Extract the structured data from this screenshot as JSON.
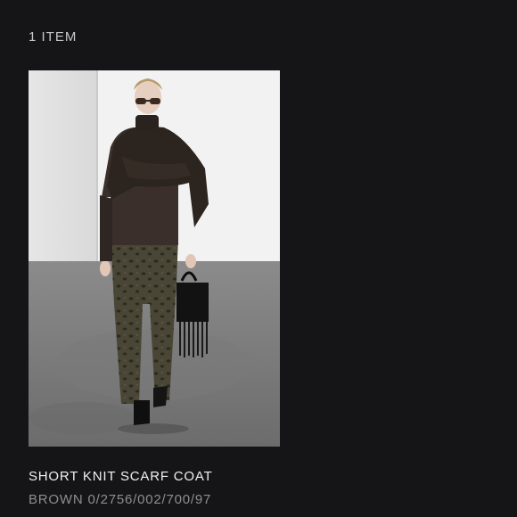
{
  "results": {
    "count_label": "1 ITEM"
  },
  "product": {
    "name": "SHORT KNIT SCARF COAT",
    "color": "BROWN",
    "reference": "0/2756/002/700/97",
    "image_alt": "Model wearing short knit scarf coat"
  }
}
